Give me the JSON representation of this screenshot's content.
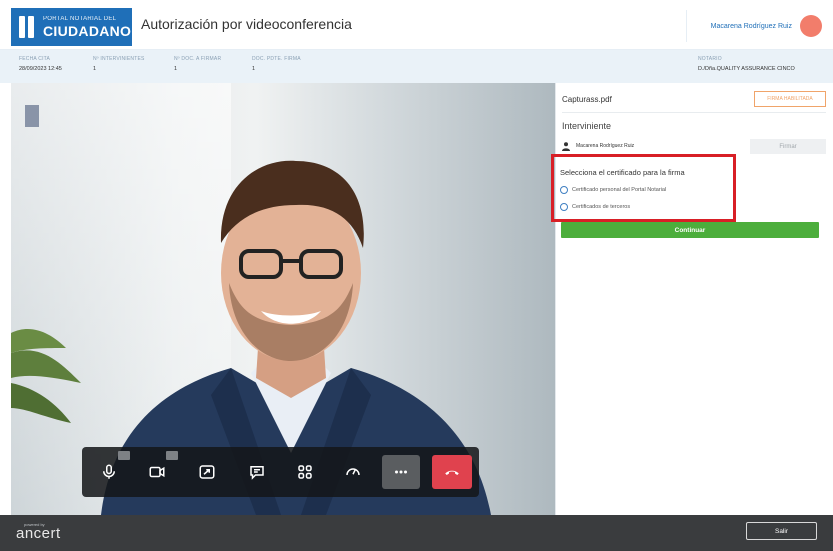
{
  "header": {
    "logo_small": "PORTAL NOTARIAL DEL",
    "logo_big": "CIUDADANO",
    "title": "Autorización por videoconferencia",
    "user_name": "Macarena Rodríguez Ruiz"
  },
  "infobar": {
    "fecha_label": "FECHA CITA",
    "fecha_value": "28/09/2023 12:45",
    "intervinientes_label": "Nº INTERVINIENTES",
    "intervinientes_value": "1",
    "doc_firmar_label": "Nº DOC. A FIRMAR",
    "doc_firmar_value": "1",
    "doc_pdte_label": "DOC. PDTE. FIRMA",
    "doc_pdte_value": "1",
    "notario_label": "NOTARIO",
    "notario_value": "D./Dña.QUALITY ASSURANCE CINCO"
  },
  "panel": {
    "doc_name": "Capturass.pdf",
    "firma_habilitada": "FIRMA HABILITADA",
    "interviniente_title": "Interviniente",
    "interviniente_name": "Macarena Rodríguez Ruiz",
    "firmar_label": "Firmar",
    "cert_title": "Selecciona el certificado para la firma",
    "cert_options": [
      "Certificado personal del Portal Notarial",
      "Certificados de terceros"
    ],
    "continue_label": "Continuar"
  },
  "footer": {
    "powered_by": "powered by",
    "brand": "ancert",
    "exit_label": "Salir"
  },
  "toolbar": {
    "icons": [
      "microphone-icon",
      "camera-icon",
      "share-screen-icon",
      "chat-icon",
      "grid-icon",
      "speed-icon",
      "more-icon",
      "hang-up-icon"
    ]
  },
  "colors": {
    "brand_blue": "#1f6fb8",
    "accent_green": "#4cae3c",
    "highlight_red": "#d81f26",
    "hangup_red": "#e0424e",
    "warning_orange": "#f0a46a"
  }
}
